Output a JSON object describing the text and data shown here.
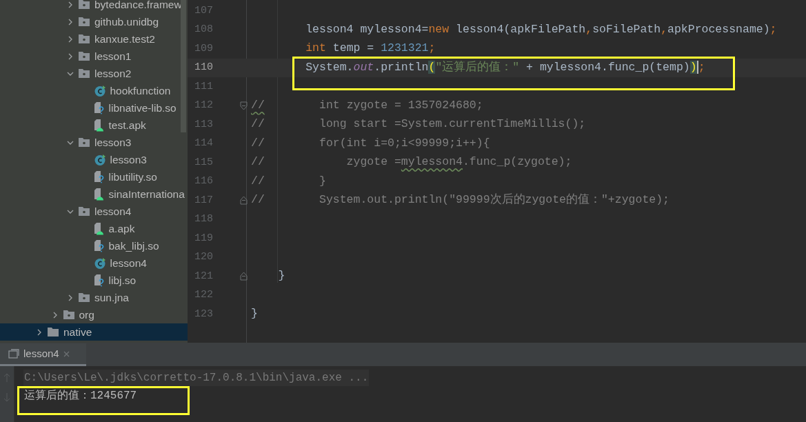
{
  "project_tree": [
    {
      "children": [
        {
          "children": [
            {
              "kind": "folder",
              "label": "bytedance.framew",
              "expanded": false,
              "selected": false
            },
            {
              "kind": "folder",
              "label": "github.unidbg",
              "expanded": false,
              "selected": false
            },
            {
              "kind": "folder",
              "label": "kanxue.test2",
              "expanded": false,
              "selected": false
            },
            {
              "kind": "folder",
              "label": "lesson1",
              "expanded": false,
              "selected": false
            },
            {
              "kind": "folder",
              "label": "lesson2",
              "expanded": true,
              "selected": false,
              "children": [
                {
                  "kind": "class",
                  "label": "hookfunction",
                  "selected": false
                },
                {
                  "kind": "native_lib",
                  "label": "libnative-lib.so",
                  "selected": false
                },
                {
                  "kind": "apk",
                  "label": "test.apk",
                  "selected": false
                }
              ]
            },
            {
              "kind": "folder",
              "label": "lesson3",
              "expanded": true,
              "selected": false,
              "children": [
                {
                  "kind": "class",
                  "label": "lesson3",
                  "selected": false
                },
                {
                  "kind": "native_lib",
                  "label": "libutility.so",
                  "selected": false
                },
                {
                  "kind": "apk",
                  "label": "sinaInternationa",
                  "selected": false
                }
              ]
            },
            {
              "kind": "folder",
              "label": "lesson4",
              "expanded": true,
              "selected": false,
              "children": [
                {
                  "kind": "apk",
                  "label": "a.apk",
                  "selected": false
                },
                {
                  "kind": "native_lib",
                  "label": "bak_libj.so",
                  "selected": false
                },
                {
                  "kind": "class",
                  "label": "lesson4",
                  "selected": false
                },
                {
                  "kind": "native_lib",
                  "label": "libj.so",
                  "selected": false
                }
              ]
            },
            {
              "kind": "folder",
              "label": "sun.jna",
              "expanded": false,
              "selected": false
            }
          ]
        },
        {
          "kind": "folder",
          "label": "org",
          "expanded": false,
          "selected": false
        }
      ]
    },
    {
      "kind": "plain_folder",
      "label": "native",
      "expanded": false,
      "selected": true
    }
  ],
  "editor": {
    "lines": [
      {
        "number": "107",
        "current": false,
        "highlighted": false,
        "fold_start": false,
        "fold_end": false
      },
      {
        "number": "108",
        "current": false,
        "highlighted": false,
        "fold_start": false,
        "fold_end": false,
        "segments": [
          {
            "kind": "plain",
            "text": "        lesson4 mylesson4="
          },
          {
            "kind": "keyword",
            "text": "new"
          },
          {
            "kind": "plain",
            "text": " lesson4(apkFilePath"
          },
          {
            "kind": "keyword",
            "text": ","
          },
          {
            "kind": "plain",
            "text": "soFilePath"
          },
          {
            "kind": "keyword",
            "text": ","
          },
          {
            "kind": "plain",
            "text": "apkProcessname)"
          },
          {
            "kind": "keyword",
            "text": ";"
          }
        ]
      },
      {
        "number": "109",
        "current": false,
        "highlighted": false,
        "fold_start": false,
        "fold_end": false,
        "segments": [
          {
            "kind": "keyword",
            "text": "        int"
          },
          {
            "kind": "plain",
            "text": " temp = "
          },
          {
            "kind": "number",
            "text": "1231321"
          },
          {
            "kind": "keyword",
            "text": ";"
          }
        ]
      },
      {
        "number": "110",
        "current": true,
        "highlighted": true,
        "fold_start": false,
        "fold_end": false,
        "segments": [
          {
            "kind": "plain",
            "text": "        System."
          },
          {
            "kind": "field",
            "text": "out"
          },
          {
            "kind": "plain",
            "text": ".println"
          },
          {
            "kind": "bracket",
            "text": "(",
            "caret_after": false
          },
          {
            "kind": "string",
            "text": "\"运算后的值：\""
          },
          {
            "kind": "plain",
            "text": " + mylesson4.func_p(temp)"
          },
          {
            "kind": "bracket",
            "text": ")",
            "caret_after": true
          },
          {
            "kind": "keyword",
            "text": ";"
          }
        ]
      },
      {
        "number": "111",
        "current": false,
        "highlighted": false,
        "fold_start": false,
        "fold_end": false
      },
      {
        "number": "112",
        "current": false,
        "highlighted": false,
        "fold_start": true,
        "fold_end": false,
        "segments": [
          {
            "kind": "comment",
            "text": "//",
            "warning": true
          },
          {
            "kind": "comment",
            "text": "        int zygote = 1357024680;",
            "warning": false
          }
        ]
      },
      {
        "number": "113",
        "current": false,
        "highlighted": false,
        "fold_start": false,
        "fold_end": false,
        "segments": [
          {
            "kind": "comment",
            "text": "//        long start =System.currentTimeMillis();",
            "warning": false
          }
        ]
      },
      {
        "number": "114",
        "current": false,
        "highlighted": false,
        "fold_start": false,
        "fold_end": false,
        "segments": [
          {
            "kind": "comment",
            "text": "//        for(int i=0;i<99999;i++){",
            "warning": false
          }
        ]
      },
      {
        "number": "115",
        "current": false,
        "highlighted": false,
        "fold_start": false,
        "fold_end": false,
        "segments": [
          {
            "kind": "comment",
            "text": "//            zygote =",
            "warning": false
          },
          {
            "kind": "comment",
            "text": "mylesson4",
            "warning": true
          },
          {
            "kind": "comment",
            "text": ".func_p(zygote);",
            "warning": false
          }
        ]
      },
      {
        "number": "116",
        "current": false,
        "highlighted": false,
        "fold_start": false,
        "fold_end": false,
        "segments": [
          {
            "kind": "comment",
            "text": "//        }",
            "warning": false
          }
        ]
      },
      {
        "number": "117",
        "current": false,
        "highlighted": false,
        "fold_start": false,
        "fold_end": true,
        "segments": [
          {
            "kind": "comment",
            "text": "//        System.out.println(\"99999次后的zygote的值：\"+zygote);",
            "warning": false
          }
        ]
      },
      {
        "number": "118",
        "current": false,
        "highlighted": false,
        "fold_start": false,
        "fold_end": false
      },
      {
        "number": "119",
        "current": false,
        "highlighted": false,
        "fold_start": false,
        "fold_end": false
      },
      {
        "number": "120",
        "current": false,
        "highlighted": false,
        "fold_start": false,
        "fold_end": false
      },
      {
        "number": "121",
        "current": false,
        "highlighted": false,
        "fold_start": false,
        "fold_end": true,
        "segments": [
          {
            "kind": "plain",
            "text": "    }"
          }
        ]
      },
      {
        "number": "122",
        "current": false,
        "highlighted": false,
        "fold_start": false,
        "fold_end": false
      },
      {
        "number": "123",
        "current": false,
        "highlighted": false,
        "fold_start": false,
        "fold_end": false,
        "segments": [
          {
            "kind": "plain",
            "text": "}"
          }
        ]
      }
    ]
  },
  "run_panel": {
    "tab": {
      "label": "lesson4",
      "selected": true
    },
    "lines": [
      {
        "kind": "command",
        "text": "C:\\Users\\Le\\.jdks\\corretto-17.0.8.1\\bin\\java.exe ...",
        "highlighted": false
      },
      {
        "kind": "output",
        "text": "运算后的值：1245677",
        "highlighted": true
      }
    ]
  }
}
